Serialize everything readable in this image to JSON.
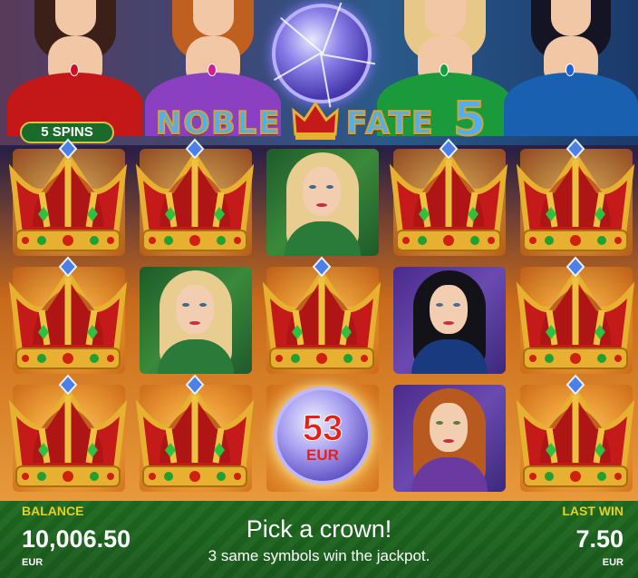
{
  "game": {
    "logo_left": "NOBLE",
    "logo_right": "FATE",
    "logo_number": "5",
    "spins_badge": "5 SPINS"
  },
  "grid": {
    "rows": [
      [
        "crown",
        "crown",
        "lady-blonde",
        "crown",
        "crown"
      ],
      [
        "crown",
        "lady-blonde",
        "crown",
        "lady-brunette",
        "crown"
      ],
      [
        "crown",
        "crown",
        "orb",
        "lady-redhead",
        "crown"
      ]
    ],
    "orb": {
      "value": "53",
      "currency": "EUR"
    }
  },
  "bottom_bar": {
    "balance_label": "BALANCE",
    "balance_value": "10,006.50",
    "balance_currency": "EUR",
    "message_title": "Pick a crown!",
    "message_sub": "3 same symbols win the jackpot.",
    "last_win_label": "LAST WIN",
    "last_win_value": "7.50",
    "last_win_currency": "EUR"
  },
  "colors": {
    "accent_yellow": "#e8d020",
    "bar_green": "#1e6a20",
    "crown_red": "#c41a1a",
    "crown_gold": "#e8b030"
  }
}
